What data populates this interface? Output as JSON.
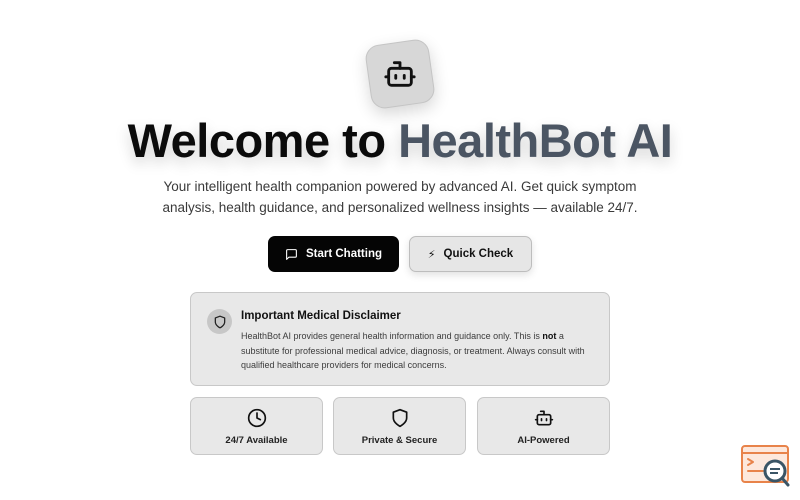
{
  "hero": {
    "title_prefix": "Welcome to",
    "title_brand": "HealthBot AI",
    "subtitle": "Your intelligent health companion powered by advanced AI. Get quick symptom analysis, health guidance, and personalized wellness insights — available 24/7."
  },
  "actions": {
    "start_chat_label": "Start Chatting",
    "quick_check_label": "Quick Check",
    "quick_check_glyph": "⚡"
  },
  "disclaimer": {
    "title": "Important Medical Disclaimer",
    "body_before": "HealthBot AI provides general health information and guidance only. This is ",
    "body_bold": "not",
    "body_after": " a substitute for professional medical advice, diagnosis, or treatment. Always consult with qualified healthcare providers for medical concerns."
  },
  "features": [
    {
      "label": "24/7 Available",
      "icon": "clock-icon"
    },
    {
      "label": "Private & Secure",
      "icon": "shield-icon"
    },
    {
      "label": "AI-Powered",
      "icon": "bot-icon"
    }
  ],
  "colors": {
    "brand_text": "#4b5563",
    "primary_button": "#050505",
    "card_background": "#e8e8e8",
    "widget_accent": "#e8834a"
  }
}
